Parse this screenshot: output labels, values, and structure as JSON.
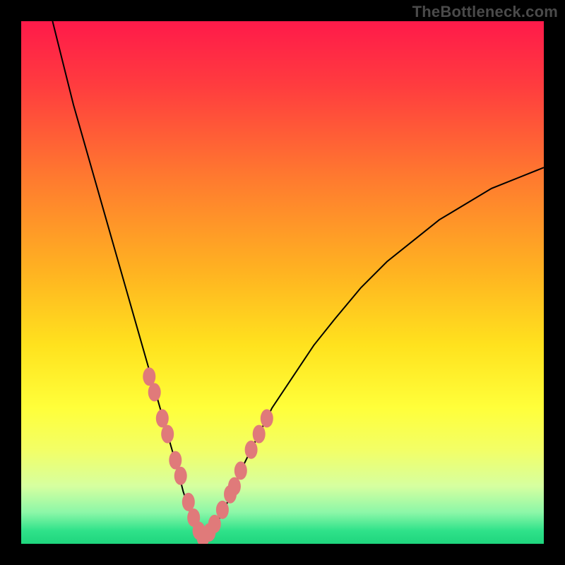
{
  "watermark": "TheBottleneck.com",
  "chart_data": {
    "type": "line",
    "title": "",
    "xlabel": "",
    "ylabel": "",
    "xlim": [
      0,
      100
    ],
    "ylim": [
      0,
      100
    ],
    "background_gradient_stops": [
      {
        "offset": 0.0,
        "color": "#ff1a4a"
      },
      {
        "offset": 0.12,
        "color": "#ff3b3f"
      },
      {
        "offset": 0.3,
        "color": "#ff7a2f"
      },
      {
        "offset": 0.48,
        "color": "#ffb321"
      },
      {
        "offset": 0.62,
        "color": "#ffe21e"
      },
      {
        "offset": 0.74,
        "color": "#ffff3a"
      },
      {
        "offset": 0.82,
        "color": "#f3ff66"
      },
      {
        "offset": 0.89,
        "color": "#d6ffa0"
      },
      {
        "offset": 0.94,
        "color": "#8cf7a8"
      },
      {
        "offset": 0.975,
        "color": "#2fe28a"
      },
      {
        "offset": 1.0,
        "color": "#1fd57d"
      }
    ],
    "series": [
      {
        "name": "bottleneck-curve",
        "x": [
          6,
          8,
          10,
          12,
          14,
          16,
          18,
          20,
          22,
          24,
          26,
          28,
          30,
          31,
          32,
          33,
          34,
          35,
          36,
          38,
          40,
          42,
          45,
          48,
          52,
          56,
          60,
          65,
          70,
          75,
          80,
          85,
          90,
          95,
          100
        ],
        "values": [
          100,
          92,
          84,
          77,
          70,
          63,
          56,
          49,
          42,
          35,
          28,
          21,
          14,
          10,
          7,
          4,
          2,
          1,
          2,
          5,
          9,
          14,
          20,
          26,
          32,
          38,
          43,
          49,
          54,
          58,
          62,
          65,
          68,
          70,
          72
        ]
      }
    ],
    "marker_points_x": [
      24.5,
      25.5,
      27.0,
      28.0,
      29.5,
      30.5,
      32.0,
      33.0,
      34.0,
      34.8,
      36.0,
      37.0,
      38.5,
      40.0,
      40.8,
      42.0,
      44.0,
      45.5,
      47.0
    ],
    "marker_points_y": [
      32,
      29,
      24,
      21,
      16,
      13,
      8,
      5,
      2.5,
      1.2,
      2.2,
      3.8,
      6.5,
      9.5,
      11,
      14,
      18,
      21,
      24
    ],
    "marker_color": "#e07a7a",
    "curve_color": "#000000"
  }
}
